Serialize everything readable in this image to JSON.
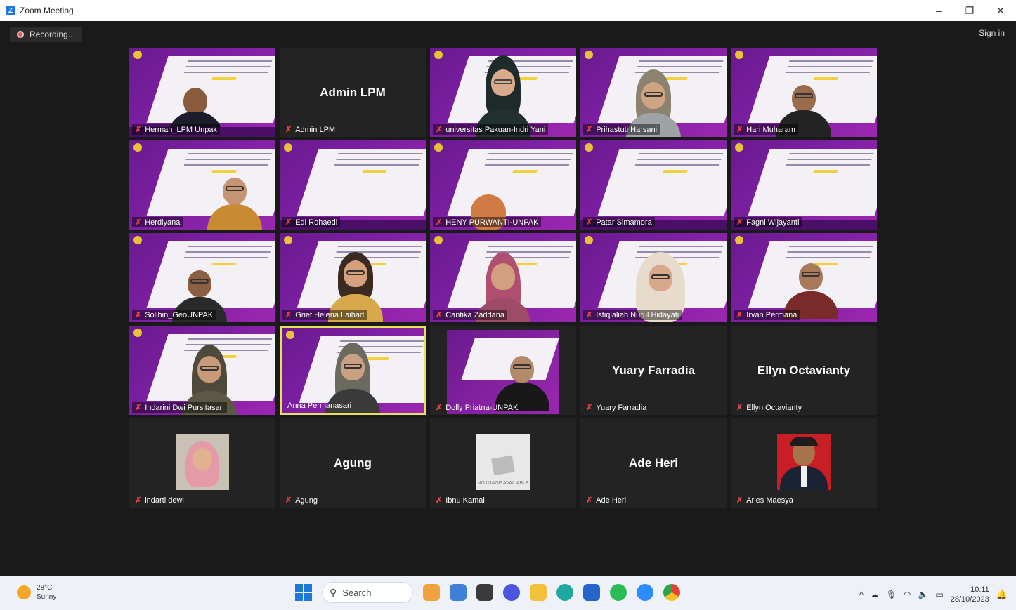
{
  "window": {
    "title": "Zoom Meeting",
    "minimize": "–",
    "restore": "❐",
    "close": "✕"
  },
  "meeting": {
    "recording_label": "Recording...",
    "signin_label": "Sign in"
  },
  "tiles": [
    {
      "name": "Herman_LPM Unpak"
    },
    {
      "name": "Admin LPM",
      "big": "Admin LPM"
    },
    {
      "name": "universitas Pakuan-Indri Yani"
    },
    {
      "name": "Prihastuti Harsani"
    },
    {
      "name": "Hari Muharam"
    },
    {
      "name": "Herdiyana"
    },
    {
      "name": "Edi Rohaedi"
    },
    {
      "name": "HENY PURWANTI-UNPAK"
    },
    {
      "name": "Patar Simamora"
    },
    {
      "name": "Fagni Wijayanti"
    },
    {
      "name": "Solihin_GeoUNPAK"
    },
    {
      "name": "Griet Helena Laihad"
    },
    {
      "name": "Cantika Zaddana"
    },
    {
      "name": "Istiqlaliah Nurul Hidayati"
    },
    {
      "name": "Irvan Permana"
    },
    {
      "name": "Indarini Dwi Pursitasari"
    },
    {
      "name": "Anna Permanasari"
    },
    {
      "name": "Dolly Priatna-UNPAK"
    },
    {
      "name": "Yuary Farradia",
      "big": "Yuary Farradia"
    },
    {
      "name": "Ellyn Octavianty",
      "big": "Ellyn Octavianty"
    },
    {
      "name": "indarti dewi"
    },
    {
      "name": "Agung",
      "big": "Agung"
    },
    {
      "name": "Ibnu Kamal",
      "noimage": "NO IMAGE AVAILABLE"
    },
    {
      "name": "Ade Heri",
      "big": "Ade Heri"
    },
    {
      "name": "Aries Maesya"
    }
  ],
  "taskbar": {
    "temperature": "28°C",
    "weather": "Sunny",
    "search_label": "Search",
    "time": "10:11",
    "date": "28/10/2023"
  }
}
